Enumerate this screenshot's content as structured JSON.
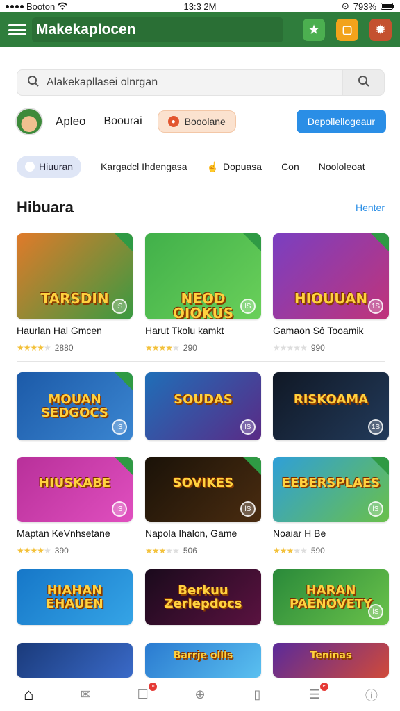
{
  "status_bar": {
    "carrier": "Booton",
    "time": "13:3 2M",
    "battery": "793%"
  },
  "app_bar": {
    "title": "Makekaplocen"
  },
  "search": {
    "placeholder": "Alakekapllasei olnrgan"
  },
  "profile": {
    "name": "Apleo",
    "link": "Boourai",
    "pill_label": "Booolane",
    "pill_icon": "coin-icon",
    "action_label": "Depollellogeaur"
  },
  "tabs": [
    {
      "label": "Hiuuran",
      "active": true
    },
    {
      "label": "Kargadcl Ihdengasa"
    },
    {
      "label": "Dopuasa"
    },
    {
      "label": "Con"
    },
    {
      "label": "Noololeoat"
    }
  ],
  "section": {
    "title": "Hibuara",
    "link": "Henter"
  },
  "games": [
    {
      "art_title": "TARSDIN",
      "title": "Haurlan Hal Gmcen",
      "stars": 4,
      "count": "2880",
      "badge": "lS",
      "bg": "#e07a2a",
      "bg2": "#3a9a42"
    },
    {
      "art_title": "NEOD OIOKUS",
      "title": "Harut Tkolu kamkt",
      "stars": 4,
      "count": "290",
      "badge": "lS",
      "bg": "#41b04a",
      "bg2": "#6ad05a"
    },
    {
      "art_title": "HIOUUAN",
      "title": "Gamaon Sô Tooamik",
      "stars": 0,
      "count": "990",
      "badge": "1S",
      "bg": "#7a3fc1",
      "bg2": "#c0347a"
    },
    {
      "art_title": "MOUAN SEDGOCS",
      "title": "",
      "stars": 0,
      "count": "",
      "badge": "lS",
      "bg": "#1c5aa8",
      "bg2": "#3b86d1"
    },
    {
      "art_title": "SOUDAS",
      "title": "",
      "stars": 0,
      "count": "",
      "badge": "lS",
      "bg": "#1f6fb8",
      "bg2": "#5a2a86"
    },
    {
      "art_title": "RISKOAMA",
      "title": "",
      "stars": 0,
      "count": "",
      "badge": "1S",
      "bg": "#101825",
      "bg2": "#223a5a"
    },
    {
      "art_title": "HIUSKABE",
      "title": "Maptan KeVnhsetane",
      "stars": 4,
      "count": "390",
      "badge": "lS",
      "bg": "#b8309a",
      "bg2": "#e04fbf"
    },
    {
      "art_title": "SOVIKES",
      "title": "Napola Ihalon, Game",
      "stars": 3,
      "count": "506",
      "badge": "lS",
      "bg": "#1a1208",
      "bg2": "#4a2c10"
    },
    {
      "art_title": "EEBERSPLAES",
      "title": "Noaiar H Be",
      "stars": 3,
      "count": "590",
      "badge": "lS",
      "bg": "#2f9fd8",
      "bg2": "#6ac04a"
    },
    {
      "art_title": "HIAHAN EHAUEN",
      "title": "",
      "stars": 0,
      "count": "",
      "badge": "",
      "bg": "#1677c8",
      "bg2": "#35a4e6"
    },
    {
      "art_title": "Berkuu Zerlepdocs",
      "title": "",
      "stars": 0,
      "count": "",
      "badge": "",
      "bg": "#1a0a1c",
      "bg2": "#5a1240"
    },
    {
      "art_title": "HARAN PAENOVETY",
      "title": "",
      "stars": 0,
      "count": "",
      "badge": "lS",
      "bg": "#2a8a3a",
      "bg2": "#6ac24a"
    },
    {
      "art_title": "",
      "title": "",
      "stars": 0,
      "count": "",
      "badge": "",
      "bg": "#1a3a7a",
      "bg2": "#3a6ac8"
    },
    {
      "art_title": "Barrje ollls",
      "title": "",
      "stars": 0,
      "count": "",
      "badge": "",
      "bg": "#2a7ad0",
      "bg2": "#5ac0f0"
    },
    {
      "art_title": "Teninas",
      "title": "",
      "stars": 0,
      "count": "",
      "badge": "",
      "bg": "#5a2a9a",
      "bg2": "#d04a3a"
    }
  ],
  "bottom_nav": [
    {
      "icon": "home-icon",
      "glyph": "⌂",
      "badge": ""
    },
    {
      "icon": "mail-icon",
      "glyph": "✉",
      "badge": ""
    },
    {
      "icon": "gift-icon",
      "glyph": "☐",
      "badge": "m"
    },
    {
      "icon": "compass-icon",
      "glyph": "⊕",
      "badge": ""
    },
    {
      "icon": "book-icon",
      "glyph": "▯",
      "badge": ""
    },
    {
      "icon": "chat-icon",
      "glyph": "☰",
      "badge": "e"
    },
    {
      "icon": "info-icon",
      "glyph": "ⓘ",
      "badge": ""
    }
  ]
}
